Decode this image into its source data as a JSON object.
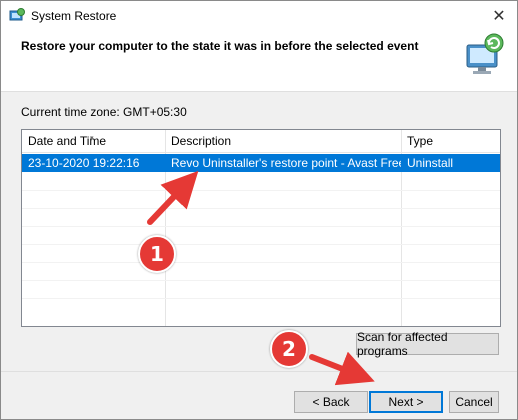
{
  "window": {
    "title": "System Restore",
    "close_glyph": "✕"
  },
  "header": {
    "heading": "Restore your computer to the state it was in before the selected event"
  },
  "timezone": {
    "label": "Current time zone: GMT+05:30"
  },
  "table": {
    "columns": [
      "Date and Time",
      "Description",
      "Type"
    ],
    "rows": [
      {
        "date": "23-10-2020 19:22:16",
        "description": "Revo Uninstaller's restore point - Avast Free Anti...",
        "type": "Uninstall"
      }
    ]
  },
  "buttons": {
    "scan": "Scan for affected programs",
    "back": "< Back",
    "next": "Next >",
    "cancel": "Cancel"
  },
  "annotations": {
    "step1": "1",
    "step2": "2"
  },
  "colors": {
    "selection": "#0078d7",
    "annotation": "#e53935"
  },
  "icons": {
    "title": "system-restore-icon",
    "header": "computer-restore-icon"
  }
}
